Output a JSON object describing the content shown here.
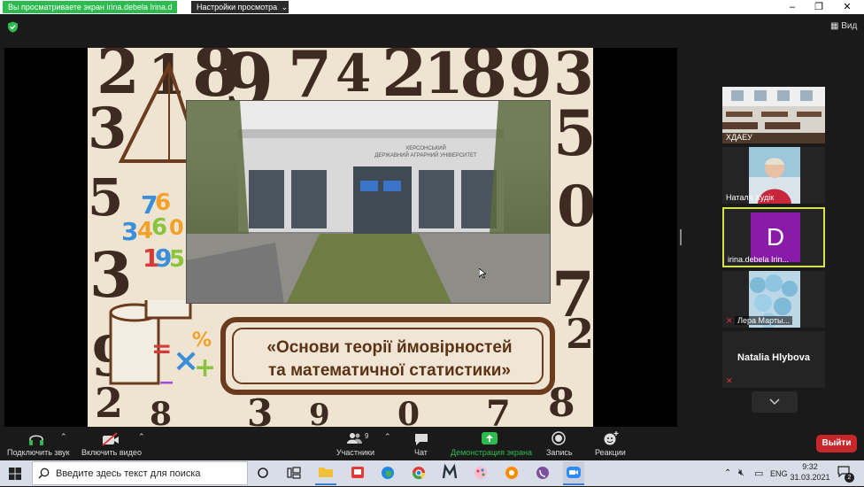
{
  "top_bar": {
    "share_notice": "Вы просматриваете экран irina.debela Irina.d",
    "view_settings": "Настройки просмотра",
    "view_settings_arrow": "⌄",
    "minimize": "–",
    "restore": "❐",
    "close": "✕"
  },
  "header": {
    "view_label": "Вид"
  },
  "slide": {
    "title_line1": "«Основи теорії ймовірностей",
    "title_line2": "та математичної статистики»",
    "building_sign_line1": "ХЕРСОНСЬКИЙ",
    "building_sign_line2": "ДЕРЖАВНИЙ АГРАРНИЙ УНІВЕРСИТЕТ"
  },
  "participants": [
    {
      "name": "ХДАЕУ",
      "kind": "video"
    },
    {
      "name": "Наталя Худік",
      "kind": "video"
    },
    {
      "name": "irina.debela Irin...",
      "kind": "avatar",
      "initial": "D",
      "avatar_color": "#8a1aa8",
      "active": true
    },
    {
      "name": "Лера Марты...",
      "kind": "video",
      "muted": true
    },
    {
      "name": "Natalia Hlybova",
      "kind": "name",
      "muted": true
    }
  ],
  "toolbar": {
    "audio": "Подключить звук",
    "video": "Включить видео",
    "participants": "Участники",
    "participants_count": "9",
    "chat": "Чат",
    "share": "Демонстрация экрана",
    "record": "Запись",
    "reactions": "Реакции",
    "leave": "Выйти",
    "accent": "#2dbb4f"
  },
  "taskbar": {
    "search_placeholder": "Введите здесь текст для поиска",
    "tray_lang": "ENG",
    "time": "9:32",
    "date": "31.03.2021",
    "notifications": "2"
  }
}
